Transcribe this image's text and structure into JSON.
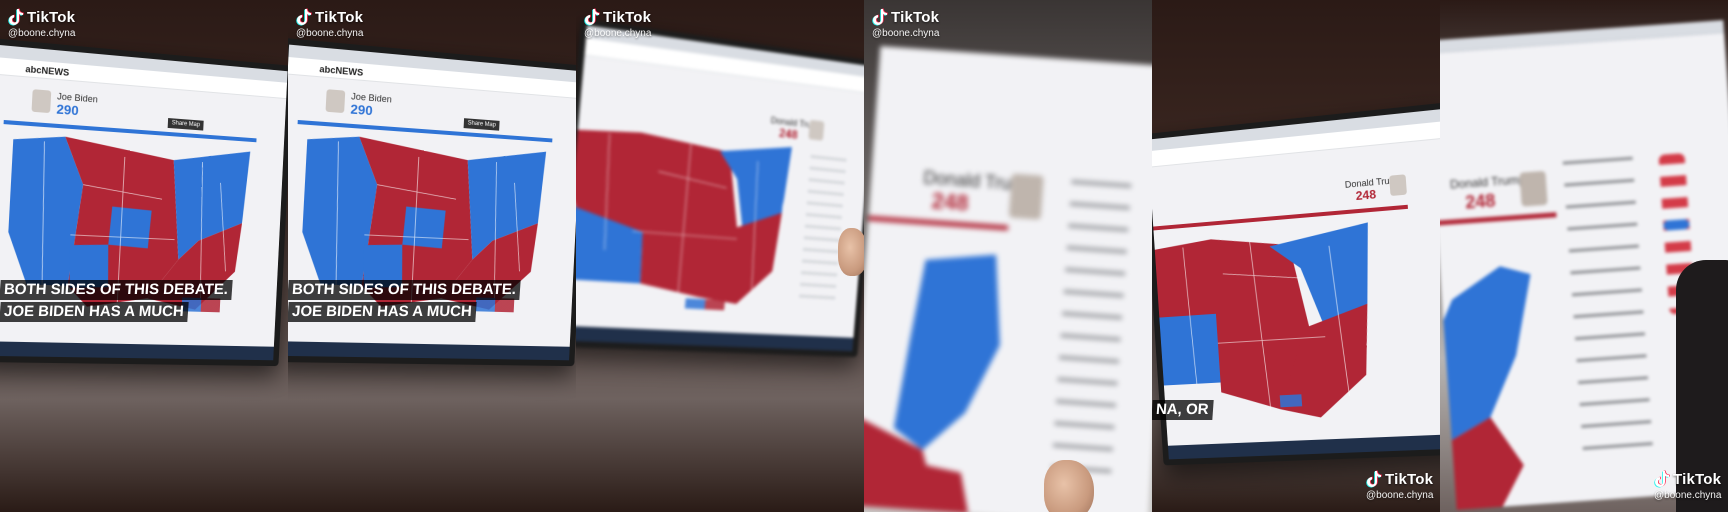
{
  "frames": [
    {
      "brand": "TikTok",
      "username": "@boone.chyna",
      "site_logo": "abcNEWS",
      "candidate_name": "Joe Biden",
      "candidate_count": "290",
      "share_button": "Share Map",
      "caption_lines": [
        "BOTH SIDES OF THIS DEBATE.",
        "JOE BIDEN HAS A MUCH"
      ]
    },
    {
      "brand": "TikTok",
      "username": "@boone.chyna",
      "site_logo": "abcNEWS",
      "candidate_name": "Joe Biden",
      "candidate_count": "290",
      "share_button": "Share Map",
      "caption_lines": [
        "BOTH SIDES OF THIS DEBATE.",
        "JOE BIDEN HAS A MUCH"
      ]
    },
    {
      "brand": "TikTok",
      "username": "@boone.chyna",
      "candidate_name": "Donald Trump",
      "candidate_count": "248"
    },
    {
      "brand": "TikTok",
      "username": "@boone.chyna",
      "candidate_name": "Donald Trump",
      "candidate_count": "248"
    },
    {
      "candidate_name": "Donald Trump",
      "candidate_count": "248",
      "caption_lines": [
        "NA, OR"
      ]
    },
    {
      "brand": "TikTok",
      "username": "@boone.chyna",
      "candidate_name": "Donald Trump",
      "candidate_count": "248"
    }
  ],
  "corner_badges": [
    {
      "brand": "TikTok",
      "username": "@boone.chyna"
    },
    {
      "brand": "TikTok",
      "username": "@boone.chyna"
    }
  ],
  "colors": {
    "democrat_blue": "#2f74d6",
    "republican_red": "#b12636",
    "screen_white": "#f2f2f5"
  },
  "icons": [
    "tiktok-logo-icon",
    "candidate-photo-icon",
    "toggle-switch-icon"
  ]
}
